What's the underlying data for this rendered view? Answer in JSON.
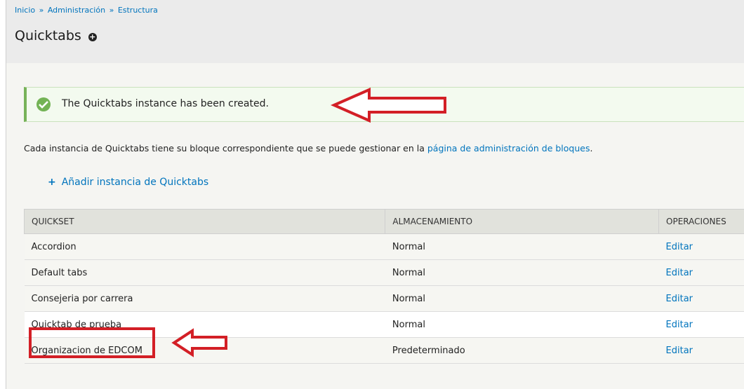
{
  "breadcrumb": [
    {
      "label": "Inicio"
    },
    {
      "label": "Administración"
    },
    {
      "label": "Estructura"
    }
  ],
  "breadcrumb_sep": "»",
  "page_title": "Quicktabs",
  "status": {
    "message": "The Quicktabs instance has been created.",
    "type": "success"
  },
  "description": {
    "text": "Cada instancia de Quicktabs tiene su bloque correspondiente que se puede gestionar en la ",
    "link": "página de administración de bloques",
    "end": "."
  },
  "add_link": {
    "icon": "+",
    "label": "Añadir instancia de Quicktabs"
  },
  "table": {
    "columns": [
      "QUICKSET",
      "ALMACENAMIENTO",
      "OPERACIONES"
    ],
    "rows": [
      {
        "name": "Accordion",
        "storage": "Normal",
        "op": "Editar"
      },
      {
        "name": "Default tabs",
        "storage": "Normal",
        "op": "Editar"
      },
      {
        "name": "Consejeria por carrera",
        "storage": "Normal",
        "op": "Editar"
      },
      {
        "name": "Quicktab de prueba",
        "storage": "Normal",
        "op": "Editar"
      },
      {
        "name": "Organizacion de EDCOM",
        "storage": "Predeterminado",
        "op": "Editar"
      }
    ]
  },
  "colors": {
    "link": "#0074bd",
    "annotation_red": "#d31f26",
    "success_green": "#73b355"
  }
}
